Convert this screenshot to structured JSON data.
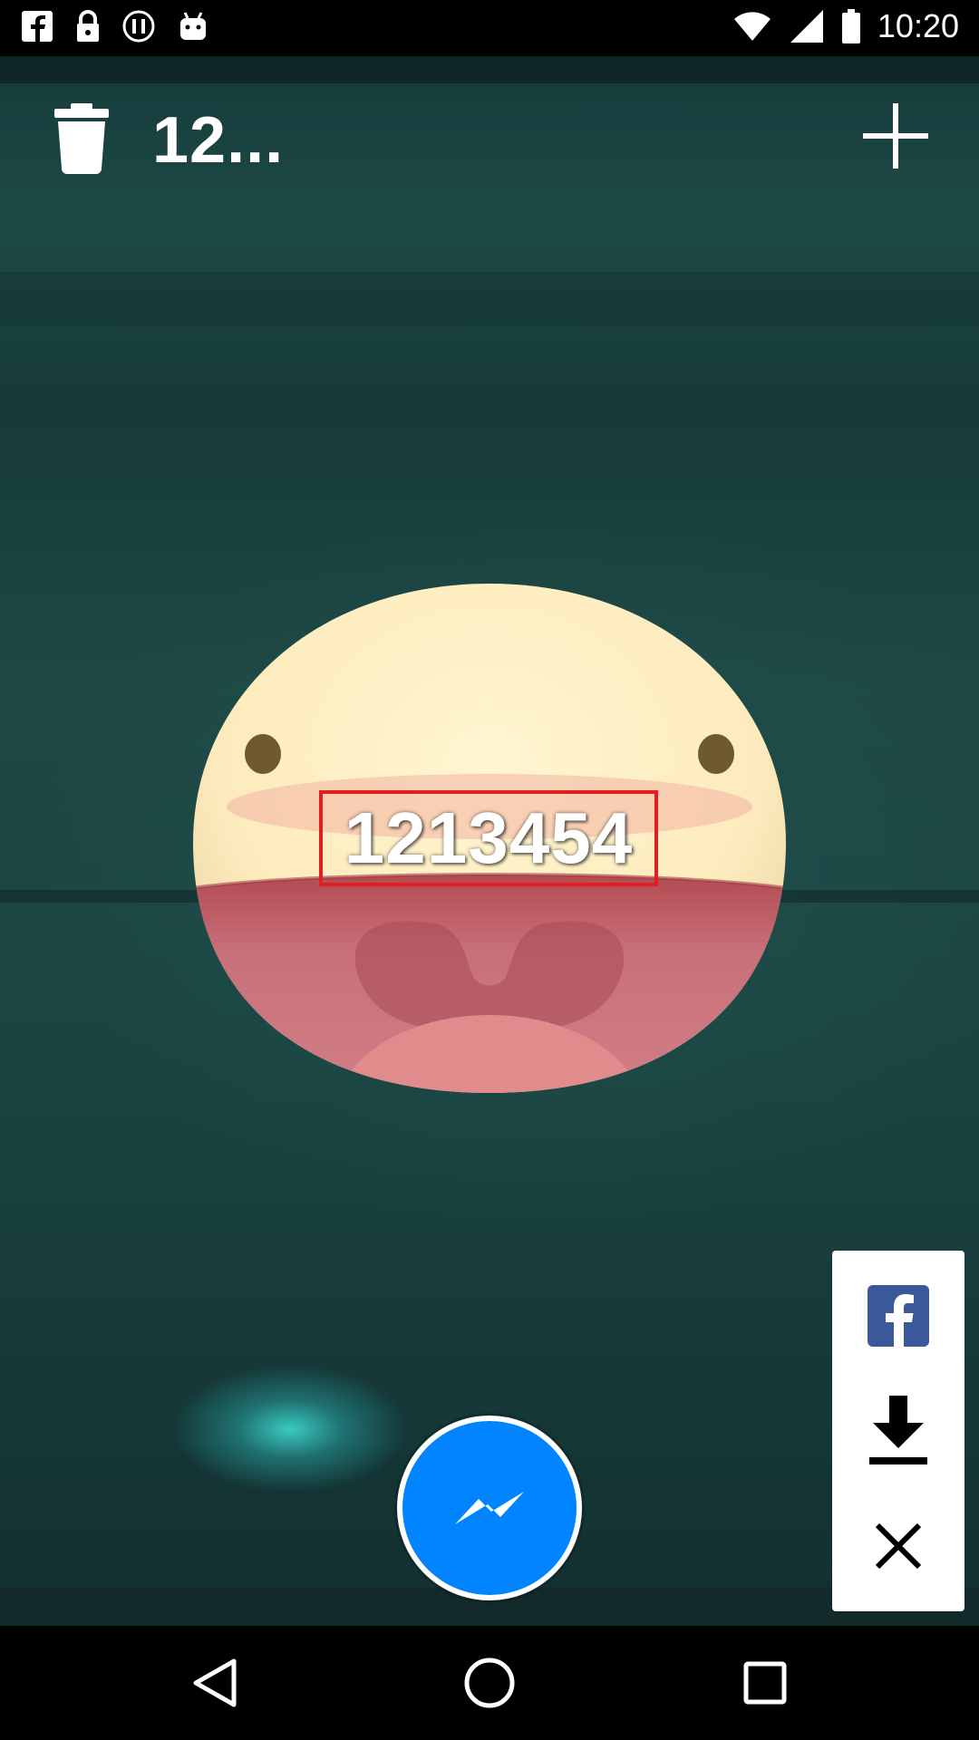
{
  "status_bar": {
    "time": "10:20",
    "left_icons": [
      "facebook-icon",
      "lock-icon",
      "alert-circle-icon",
      "android-icon"
    ],
    "right_icons": [
      "wifi-icon",
      "signal-icon",
      "battery-icon"
    ]
  },
  "toolbar": {
    "title": "12...",
    "left_icon": "trash-icon",
    "right_icon": "plus-icon"
  },
  "sticker": {
    "caption": "1213454",
    "caption_border_color": "#e02020"
  },
  "share_panel": {
    "items": [
      "facebook-icon",
      "download-icon",
      "close-icon"
    ],
    "facebook_color": "#3b5998"
  },
  "send_button": {
    "icon": "messenger-icon",
    "color": "#0084ff"
  },
  "nav_bar": {
    "items": [
      "back-icon",
      "home-icon",
      "recents-icon"
    ]
  }
}
